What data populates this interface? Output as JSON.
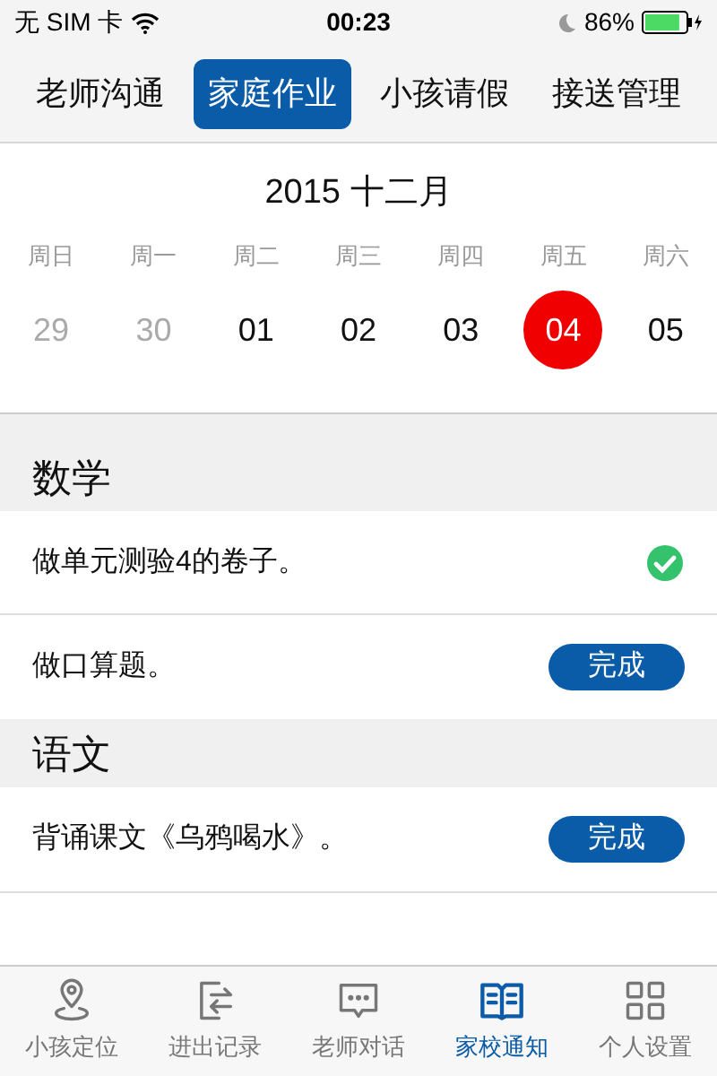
{
  "status_bar": {
    "carrier": "无 SIM 卡",
    "time": "00:23",
    "battery": {
      "text": "86%",
      "level": 0.86
    }
  },
  "tabs": [
    {
      "label": "老师沟通",
      "selected": false
    },
    {
      "label": "家庭作业",
      "selected": true
    },
    {
      "label": "小孩请假",
      "selected": false
    },
    {
      "label": "接送管理",
      "selected": false
    }
  ],
  "calendar": {
    "month": "2015 十二月",
    "weekdays": [
      "周日",
      "周一",
      "周二",
      "周三",
      "周四",
      "周五",
      "周六"
    ],
    "days": [
      {
        "label": "29",
        "other_month": true,
        "selected": false
      },
      {
        "label": "30",
        "other_month": true,
        "selected": false
      },
      {
        "label": "01",
        "other_month": false,
        "selected": false
      },
      {
        "label": "02",
        "other_month": false,
        "selected": false
      },
      {
        "label": "03",
        "other_month": false,
        "selected": false
      },
      {
        "label": "04",
        "other_month": false,
        "selected": true
      },
      {
        "label": "05",
        "other_month": false,
        "selected": false
      }
    ]
  },
  "subjects": [
    {
      "title": "数学",
      "tasks": [
        {
          "text": "做单元测验4的卷子。",
          "kind": "done"
        },
        {
          "text": "做口算题。",
          "kind": "action",
          "button": "完成"
        }
      ]
    },
    {
      "title": "语文",
      "tasks": [
        {
          "text": "背诵课文《乌鸦喝水》。",
          "kind": "action",
          "button": "完成"
        }
      ]
    }
  ],
  "bottom_tabs": [
    {
      "label": "小孩定位",
      "kind": "pin",
      "selected": false
    },
    {
      "label": "进出记录",
      "kind": "arrows",
      "selected": false
    },
    {
      "label": "老师对话",
      "kind": "chat",
      "selected": false
    },
    {
      "label": "家校通知",
      "kind": "book",
      "selected": true
    },
    {
      "label": "个人设置",
      "kind": "grid",
      "selected": false
    }
  ]
}
